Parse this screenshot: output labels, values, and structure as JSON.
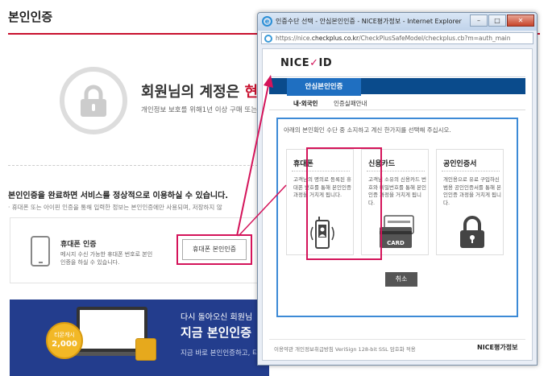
{
  "bg": {
    "title": "본인인증",
    "headline_a": "회원님의 계정은 ",
    "headline_b": "현",
    "sub": "개인정보 보호를 위해1년 이상 구매 또는",
    "complete": "본인인증을 완료하면 서비스를 정상적으로 이용하실 수 있습니다.",
    "note": "· 휴대폰 또는 아이핀 인증을 통해 입력한 정보는 본인인증에만 사용되며, 저장하지 않",
    "phone_title": "휴대폰 인증",
    "phone_desc": "메시지 수신 가능한 휴대폰 번호로 본인인증을 하실 수 있습니다.",
    "phone_btn": "휴대폰 본인인증",
    "banner_t1": "다시 돌아오신 회원님",
    "banner_t2": "지금 본인인증",
    "banner_t3": "지금 바로 본인인증하고, 티",
    "coin_label": "티몬캐시",
    "coin_amount": "2,000"
  },
  "window": {
    "title": "인증수단 선택 - 안심본인인증 - NICE평가정보 - Internet Explorer",
    "url_prefix": "https://nice.",
    "url_host": "checkplus.co.kr",
    "url_path": "/CheckPlusSafeModel/checkplus.cb?m=auth_main",
    "controls": {
      "minimize": "–",
      "maximize": "□",
      "close": "✕"
    }
  },
  "popup": {
    "logo_a": "NICE",
    "logo_b": "✓",
    "logo_c": "ID",
    "tab": "안심본인인증",
    "subtabs": [
      "내·외국인",
      "인증실패안내"
    ],
    "instruction": "아래의 본인확인 수단 중 소지하고 계신 한가지를 선택해 주십시오.",
    "cards": [
      {
        "title": "휴대폰",
        "desc": "고객님의 명의로 등록된 휴대폰 번호를 통해 본인인증 과정을 거치게 됩니다."
      },
      {
        "title": "신용카드",
        "desc": "고객님 소유의 신용카드 번호와 비밀번호를 통해 본인인증 과정을 거치게 됩니다."
      },
      {
        "title": "공인인증서",
        "desc": "개인용으로 유료 구입하신 범용 공인인증서를 통해 본인인증 과정을 거치게 됩니다."
      }
    ],
    "card_label": "CARD",
    "cancel": "취소",
    "footer_links": "이용약관   개인정보취급방침   VeriSign 128-bit SSL 암호화 적용",
    "footer_brand": "NICE평가정보"
  },
  "colors": {
    "accent": "#c8102e",
    "highlight": "#d4145a",
    "nav": "#0a4b8c",
    "tab": "#1f6fc1",
    "banner": "#233d8d"
  }
}
